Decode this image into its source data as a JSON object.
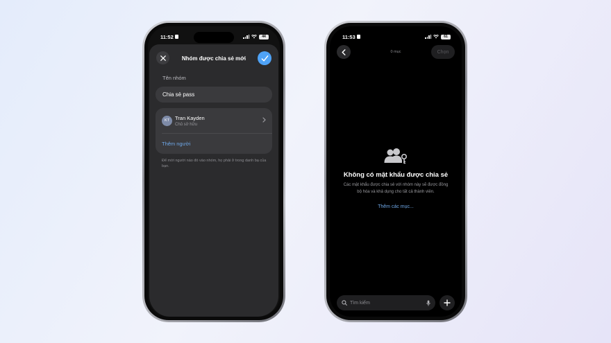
{
  "left_phone": {
    "status": {
      "time": "11:52",
      "battery": "44"
    },
    "sheet": {
      "title": "Nhóm được chia sẻ mới",
      "group_name_label": "Tên nhóm",
      "group_name_value": "Chia sẻ pass",
      "member": {
        "initials": "KT",
        "name": "Tran Kayden",
        "role": "Chủ sở hữu"
      },
      "add_person_label": "Thêm người",
      "helper_text": "Để mời người nào đó vào nhóm, họ phải ở trong danh bạ của bạn."
    }
  },
  "right_phone": {
    "status": {
      "time": "11:53",
      "battery": "61"
    },
    "nav": {
      "item_count": "0 mục",
      "select_label": "Chọn"
    },
    "empty_state": {
      "title": "Không có mật khẩu được chia sẻ",
      "description": "Các mật khẩu được chia sẻ với nhóm này sẽ được đồng bộ hóa và khả dụng cho tất cả thành viên.",
      "link_label": "Thêm các mục..."
    },
    "search": {
      "placeholder": "Tìm kiếm"
    }
  },
  "colors": {
    "accent": "#4fa3f7",
    "link": "#6fa8e8",
    "sheet_bg": "#2b2b2d"
  },
  "icons": [
    "close-icon",
    "checkmark-icon",
    "chevron-right-icon",
    "back-chevron-icon",
    "shared-group-key-icon",
    "search-icon",
    "microphone-icon",
    "plus-icon"
  ]
}
